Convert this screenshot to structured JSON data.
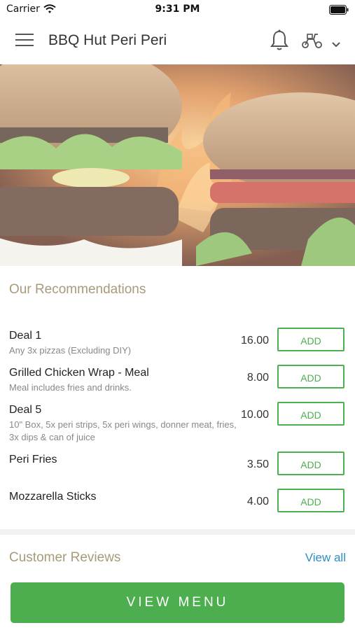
{
  "status_bar": {
    "carrier": "Carrier",
    "time": "9:31 PM"
  },
  "header": {
    "title": "BBQ Hut Peri Peri"
  },
  "recommendations": {
    "title": "Our Recommendations",
    "add_label": "ADD",
    "items": [
      {
        "name": "Deal 1",
        "description": "Any 3x pizzas (Excluding DIY)",
        "price": "16.00"
      },
      {
        "name": "Grilled Chicken Wrap - Meal",
        "description": "Meal includes fries and drinks.",
        "price": "8.00"
      },
      {
        "name": "Deal 5",
        "description": "10\" Box, 5x peri strips, 5x peri wings, donner meat, fries, 3x dips & can of juice",
        "price": "10.00"
      },
      {
        "name": "Peri Fries",
        "description": "",
        "price": "3.50"
      },
      {
        "name": "Mozzarella Sticks",
        "description": "",
        "price": "4.00"
      }
    ]
  },
  "reviews": {
    "title": "Customer Reviews",
    "view_all": "View all"
  },
  "footer": {
    "view_menu": "VIEW MENU"
  },
  "colors": {
    "accent_green": "#4cae4f",
    "section_title": "#a89a7a",
    "link_blue": "#2a8fc4"
  },
  "icons": [
    "wifi-icon",
    "battery-icon",
    "hamburger-menu-icon",
    "bell-icon",
    "scooter-icon",
    "chevron-down-icon"
  ]
}
